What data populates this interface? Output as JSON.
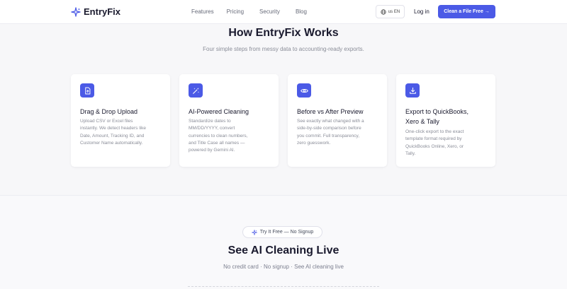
{
  "header": {
    "brand": "EntryFix",
    "nav": [
      "Features",
      "Pricing",
      "Security",
      "Blog"
    ],
    "lang_label": "us EN",
    "login_label": "Log in",
    "cta_label": "Clean a File Free →"
  },
  "how": {
    "title": "How EntryFix Works",
    "subtitle": "Four simple steps from messy data to accounting-ready exports.",
    "steps": [
      {
        "icon": "file-upload-icon",
        "title": "Drag & Drop Upload",
        "desc": [
          "Upload CSV or Excel files",
          "instantly. We detect headers like",
          "Date, Amount, Tracking ID, and",
          "Customer Name automatically."
        ]
      },
      {
        "icon": "magic-wand-icon",
        "title": "AI-Powered Cleaning",
        "desc": [
          "Standardize dates to",
          "MM/DD/YYYY, convert",
          "currencies to clean numbers,",
          "and Title Case all names —",
          "powered by Gemini AI."
        ]
      },
      {
        "icon": "eye-icon",
        "title": "Before vs After Preview",
        "desc": [
          "See exactly what changed with a",
          "side-by-side comparison before",
          "you commit. Full transparency,",
          "zero guesswork."
        ]
      },
      {
        "icon": "download-icon",
        "title_lines": [
          "Export to QuickBooks,",
          "Xero & Tally"
        ],
        "desc": [
          "One-click export to the exact",
          "template format required by",
          "QuickBooks Online, Xero, or",
          "Tally."
        ]
      }
    ]
  },
  "live": {
    "pill": "Try It Free — No Signup",
    "title": "See AI Cleaning Live",
    "subtitle": "No credit card · No signup · See AI cleaning live"
  },
  "colors": {
    "accent": "#4b5ae6",
    "text_dark": "#1a1a2e",
    "text_muted": "#8a8d98"
  }
}
